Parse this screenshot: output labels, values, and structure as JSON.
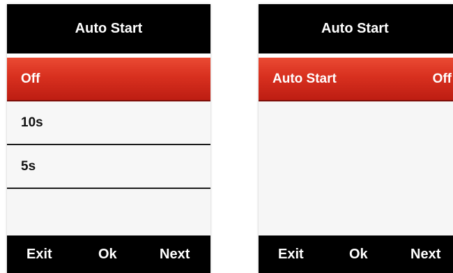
{
  "left_screen": {
    "title": "Auto Start",
    "options": [
      {
        "label": "Off",
        "selected": true
      },
      {
        "label": "10s",
        "selected": false
      },
      {
        "label": "5s",
        "selected": false
      }
    ],
    "footer": {
      "exit": "Exit",
      "ok": "Ok",
      "next": "Next"
    }
  },
  "right_screen": {
    "title": "Auto Start",
    "setting": {
      "label": "Auto Start",
      "value": "Off",
      "selected": true
    },
    "footer": {
      "exit": "Exit",
      "ok": "Ok",
      "next": "Next"
    }
  },
  "colors": {
    "header": "#000000",
    "selection": "#d8301f",
    "background": "#f6f6f6"
  }
}
